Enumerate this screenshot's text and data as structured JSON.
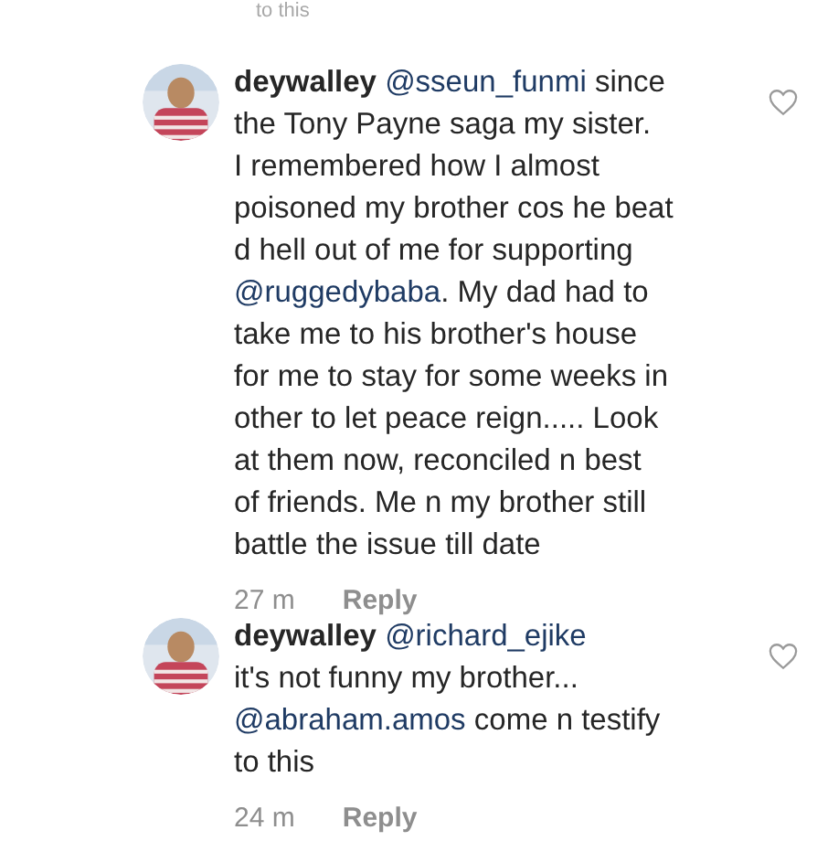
{
  "previous_tail": "to this",
  "comments": [
    {
      "username": "deywalley",
      "lines": [
        [
          {
            "kind": "mention",
            "text": "@sseun_funmi"
          },
          {
            "kind": "text",
            "text": " since"
          }
        ],
        [
          {
            "kind": "text",
            "text": "the Tony Payne saga my sister."
          }
        ],
        [
          {
            "kind": "text",
            "text": "I remembered how I almost"
          }
        ],
        [
          {
            "kind": "text",
            "text": "poisoned my brother cos he beat"
          }
        ],
        [
          {
            "kind": "text",
            "text": "d hell out of me for supporting"
          }
        ],
        [
          {
            "kind": "mention",
            "text": "@ruggedybaba"
          },
          {
            "kind": "text",
            "text": ". My dad had to"
          }
        ],
        [
          {
            "kind": "text",
            "text": "take me to his brother's house"
          }
        ],
        [
          {
            "kind": "text",
            "text": "for me to stay for some weeks in"
          }
        ],
        [
          {
            "kind": "text",
            "text": "other to let peace reign..... Look"
          }
        ],
        [
          {
            "kind": "text",
            "text": "at them now, reconciled n best"
          }
        ],
        [
          {
            "kind": "text",
            "text": "of friends. Me n my brother still"
          }
        ],
        [
          {
            "kind": "text",
            "text": "battle the issue till date"
          }
        ]
      ],
      "time": "27 m",
      "reply": "Reply",
      "liked": false
    },
    {
      "username": "deywalley",
      "lines": [
        [
          {
            "kind": "mention",
            "text": "@richard_ejike"
          }
        ],
        [
          {
            "kind": "text",
            "text": "it's not funny my brother..."
          }
        ],
        [
          {
            "kind": "mention",
            "text": "@abraham.amos"
          },
          {
            "kind": "text",
            "text": " come n testify"
          }
        ],
        [
          {
            "kind": "text",
            "text": "to this"
          }
        ]
      ],
      "time": "24 m",
      "reply": "Reply",
      "liked": false
    }
  ]
}
